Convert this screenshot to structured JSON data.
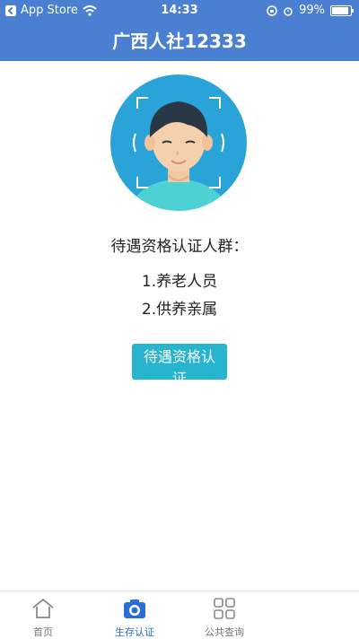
{
  "status_bar": {
    "carrier": "App Store",
    "time": "14:33",
    "battery": "99%"
  },
  "header": {
    "title": "广西人社12333"
  },
  "main": {
    "section_title": "待遇资格认证人群：",
    "items": [
      "1.养老人员",
      "2.供养亲属"
    ],
    "button_label": "待遇资格认证"
  },
  "tabbar": {
    "items": [
      {
        "label": "首页",
        "icon": "home-icon"
      },
      {
        "label": "生存认证",
        "icon": "camera-icon",
        "active": true
      },
      {
        "label": "公共查询",
        "icon": "grid-icon"
      }
    ]
  },
  "colors": {
    "header_bg": "#4a7fd2",
    "button_bg": "#27b4cf",
    "tab_active": "#2a6fd6",
    "avatar_bg": "#2aa3d8"
  }
}
